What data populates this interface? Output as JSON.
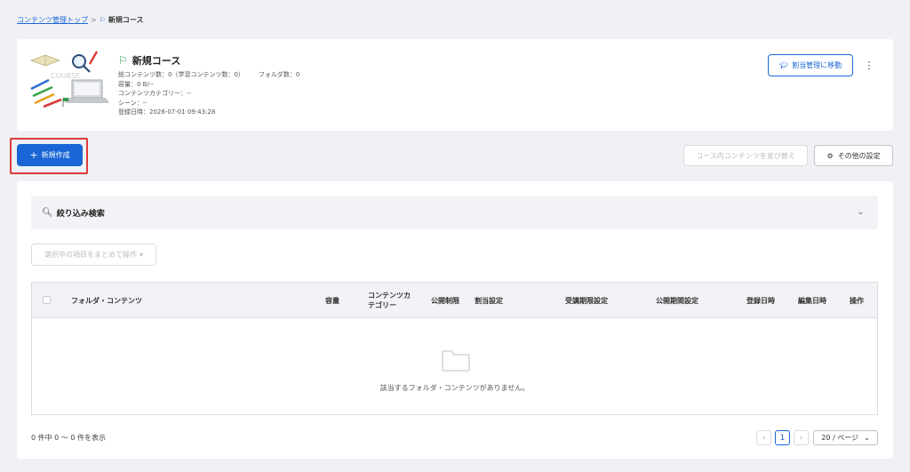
{
  "breadcrumb": {
    "root": "コンテンツ管理トップ",
    "separator": ">",
    "current": "新規コース"
  },
  "course": {
    "title": "新規コース",
    "total_contents": "総コンテンツ数：0（学習コンテンツ数：0）",
    "folders": "フォルダ数：0",
    "capacity": "容量：0 B/--",
    "category": "コンテンツカテゴリー：--",
    "scene": "シーン：--",
    "registered": "登録日時：2026-07-01 09:43:28",
    "thumbnail_caption": "COURSE"
  },
  "header_actions": {
    "go_to_assignment": "割当管理に移動",
    "more": "⋮"
  },
  "toolbar": {
    "new_label": "新規作成",
    "reorder_label": "コース内コンテンツを並び替え",
    "other_settings_label": "その他の設定"
  },
  "filter": {
    "title": "絞り込み検索"
  },
  "bulk_action": {
    "label": "選択中の項目をまとめて操作"
  },
  "table": {
    "headers": [
      "フォルダ・コンテンツ",
      "容量",
      "コンテンツカテゴリー",
      "公開制限",
      "割当設定",
      "受講期限設定",
      "公開期間設定",
      "登録日時",
      "編集日時",
      "操作"
    ],
    "header_category_line1": "コンテンツカ",
    "header_category_line2": "テゴリー",
    "empty_message": "該当するフォルダ・コンテンツがありません。"
  },
  "pagination": {
    "summary": "0 件中 0 ～ 0 件を表示",
    "current_page": "1",
    "page_size": "20 / ページ"
  },
  "colors": {
    "primary": "#1a66d6",
    "highlight": "#e03a3a",
    "flag": "#2e9d4b",
    "background": "#f0f1f5"
  }
}
